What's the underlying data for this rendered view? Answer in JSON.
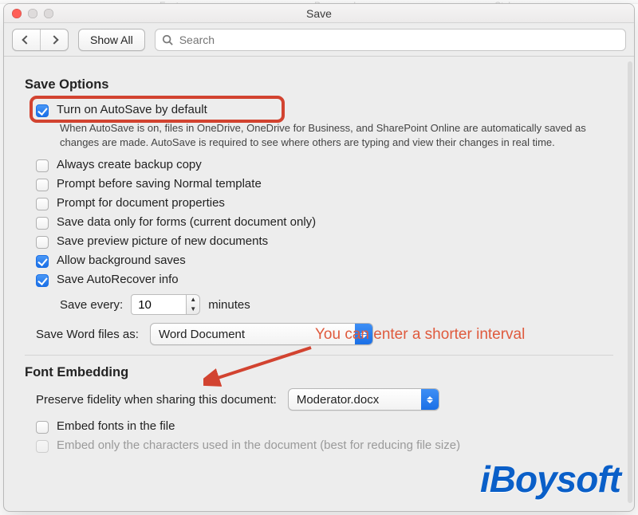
{
  "background_tabs": [
    "Font",
    "Paragraph",
    "Styles"
  ],
  "window": {
    "title": "Save"
  },
  "toolbar": {
    "show_all": "Show All",
    "search_placeholder": "Search"
  },
  "sections": {
    "save_options": {
      "title": "Save Options",
      "autosave": {
        "label": "Turn on AutoSave by default",
        "help": "When AutoSave is on, files in OneDrive, OneDrive for Business, and SharePoint Online are automatically saved as changes are made. AutoSave is required to see where others are typing and view their changes in real time.",
        "checked": true
      },
      "backup_copy": {
        "label": "Always create backup copy",
        "checked": false
      },
      "prompt_normal": {
        "label": "Prompt before saving Normal template",
        "checked": false
      },
      "prompt_docprops": {
        "label": "Prompt for document properties",
        "checked": false
      },
      "save_forms_only": {
        "label": "Save data only for forms (current document only)",
        "checked": false
      },
      "save_preview": {
        "label": "Save preview picture of new documents",
        "checked": false
      },
      "background_saves": {
        "label": "Allow background saves",
        "checked": true
      },
      "autorecover": {
        "label": "Save AutoRecover info",
        "checked": true
      },
      "save_every": {
        "label": "Save every:",
        "value": "10",
        "unit": "minutes"
      },
      "save_files_as": {
        "label": "Save Word files as:",
        "value": "Word Document"
      }
    },
    "font_embedding": {
      "title": "Font Embedding",
      "preserve_fidelity": {
        "label": "Preserve fidelity when sharing this document:",
        "value": "Moderator.docx"
      },
      "embed_fonts": {
        "label": "Embed fonts in the file",
        "checked": false
      },
      "embed_only_used": {
        "label": "Embed only the characters used in the document (best for reducing file size)",
        "checked": false,
        "disabled": true
      }
    }
  },
  "annotation": {
    "text": "You can enter a shorter interval"
  },
  "watermark": "iBoysoft"
}
